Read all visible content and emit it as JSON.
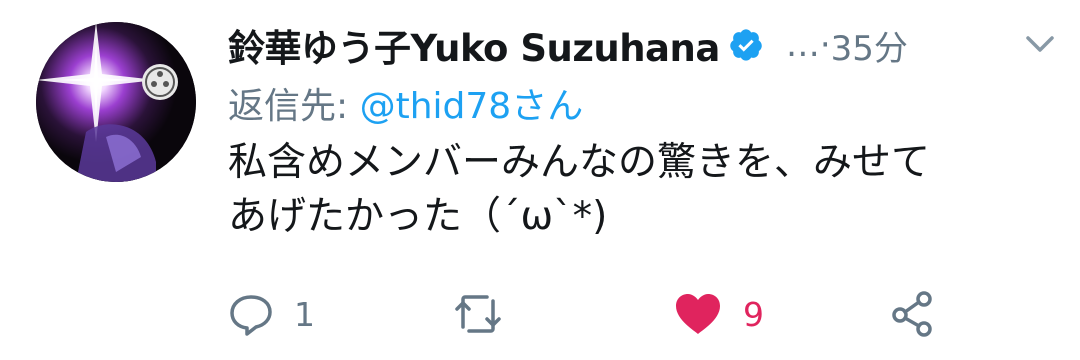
{
  "tweet": {
    "display_name": "鈴華ゆう子Yuko Suzuhana",
    "ellipsis": "…·",
    "time": "35分",
    "reply_prefix": "返信先:",
    "reply_to": "@thid78さん",
    "text": "私含めメンバーみんなの驚きを、みせて\nあげたかった（´ω`*)",
    "actions": {
      "reply_count": "1",
      "retweet_count": "",
      "like_count": "9"
    }
  },
  "colors": {
    "accent": "#1da1f2",
    "like": "#e0245e",
    "secondary": "#657786"
  },
  "icons": [
    "verified-badge-icon",
    "chevron-down-icon",
    "reply-icon",
    "retweet-icon",
    "heart-icon",
    "share-icon"
  ]
}
